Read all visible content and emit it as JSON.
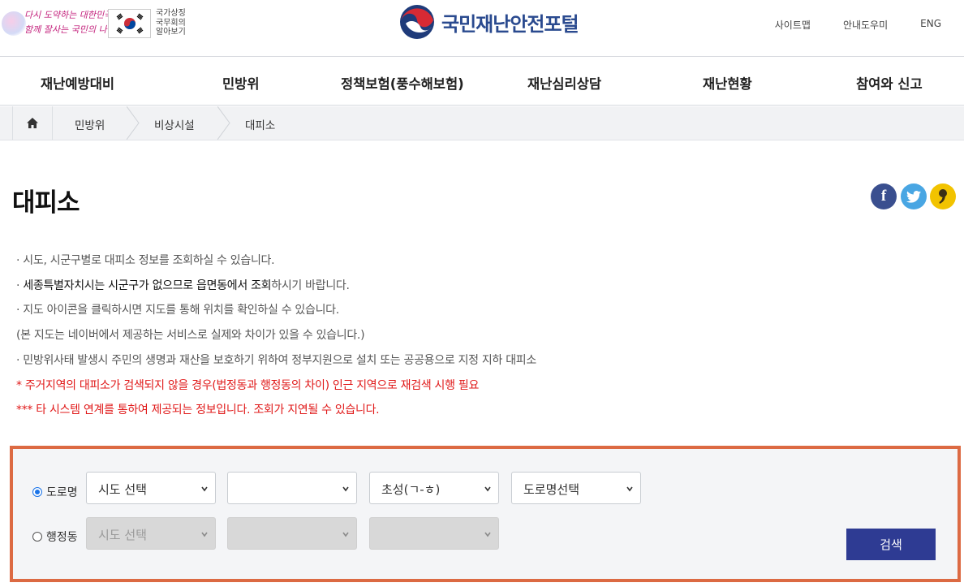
{
  "header": {
    "slogan_line1": "다시 도약하는 대한민국",
    "slogan_line2": "함께 잘사는 국민의 나라",
    "symbols_line1": "국가상징",
    "symbols_line2": "국무회의",
    "symbols_line3": "알아보기",
    "logo_text": "국민재난안전포털",
    "util": {
      "sitemap": "사이트맵",
      "help": "안내도우미",
      "eng": "ENG"
    }
  },
  "nav": [
    "재난예방대비",
    "민방위",
    "정책보험(풍수해보험)",
    "재난심리상담",
    "재난현황",
    "참여와 신고"
  ],
  "breadcrumb": [
    "민방위",
    "비상시설",
    "대피소"
  ],
  "page_title": "대피소",
  "info": {
    "line1": "· 시도, 시군구별로 대피소 정보를 조회하실 수 있습니다.",
    "line2_prefix": "· ",
    "line2_dark": "세종특별자치시는 시군구가 없으므로 읍면동에서 조회",
    "line2_rest": "하시기 바랍니다.",
    "line3": "· 지도 아이콘을 클릭하시면 지도를 통해 위치를 확인하실 수 있습니다.",
    "line4": "(본 지도는 네이버에서 제공하는 서비스로 실제와 차이가 있을 수 있습니다.)",
    "line5": "· 민방위사태 발생시 주민의 생명과 재산을 보호하기 위하여 정부지원으로 설치 또는 공공용으로 지정 지하 대피소",
    "line6": "* 주거지역의 대피소가 검색되지 않을 경우(법정동과 행정동의 차이) 인근 지역으로 재검색 시행 필요",
    "line7": "*** 타 시스템 연계를 통하여 제공되는 정보입니다. 조회가 지연될 수 있습니다."
  },
  "search": {
    "road_label": "도로명",
    "admin_label": "행정동",
    "road_selected": true,
    "road_selects": [
      "시도 선택",
      "",
      "초성(ㄱ-ㅎ)",
      "도로명선택"
    ],
    "admin_selects": [
      "시도 선택",
      "",
      ""
    ],
    "button": "검색"
  },
  "colors": {
    "brand_blue": "#2a4a8f",
    "search_button": "#2e3b93",
    "highlight_border": "#dc6a43",
    "warning_red": "#e01818"
  },
  "icons": [
    "home-icon",
    "facebook-icon",
    "twitter-icon",
    "kakao-icon",
    "chevron-down-icon",
    "taegukgi-flag-icon"
  ]
}
